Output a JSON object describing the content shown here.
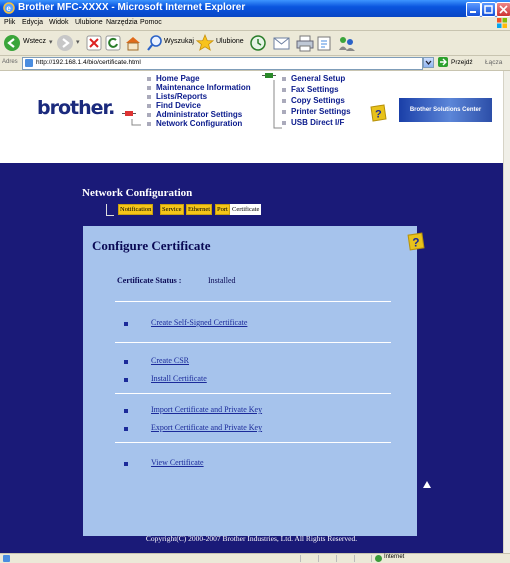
{
  "window": {
    "title": "Brother MFC-XXXX - Microsoft Internet Explorer"
  },
  "menu": [
    "Plik",
    "Edycja",
    "Widok",
    "Ulubione",
    "Narzędzia",
    "Pomoc"
  ],
  "toolbar": {
    "back_label": "Wstecz",
    "search_label": "Wyszukaj",
    "favorites_label": "Ulubione"
  },
  "address": {
    "label": "Adres",
    "url": "http://192.168.1.4/bio/certificate.html",
    "go_label": "Przejdź",
    "links_label": "Łącza"
  },
  "header": {
    "logo": "brother.",
    "nav_left": [
      "Home Page",
      "Maintenance Information",
      "Lists/Reports",
      "Find Device",
      "Administrator Settings",
      "Network Configuration"
    ],
    "nav_right": [
      "General Setup",
      "Fax Settings",
      "Copy Settings",
      "Printer Settings",
      "USB Direct I/F"
    ],
    "banner": "Brother Solutions Center"
  },
  "netconfig": {
    "title": "Network Configuration",
    "tabs": [
      "Notification",
      "Service",
      "Ethernet",
      "Port",
      "Certificate"
    ]
  },
  "panel": {
    "title": "Configure Certificate",
    "status_label": "Certificate Status :",
    "status_value": "Installed",
    "links": [
      "Create Self-Signed Certificate",
      "Create CSR",
      "Install Certificate",
      "Import Certificate and Private Key",
      "Export Certificate and Private Key",
      "View Certificate"
    ]
  },
  "footer": {
    "copyright": "Copyright(C) 2000-2007 Brother Industries, Ltd. All Rights Reserved."
  },
  "statusbar": {
    "zone": "Internet"
  },
  "colors": {
    "page_bg": "#1a1a78",
    "panel_bg": "#a6c3ec",
    "tab_bg": "#f5c518",
    "link": "#1b2a9a"
  }
}
